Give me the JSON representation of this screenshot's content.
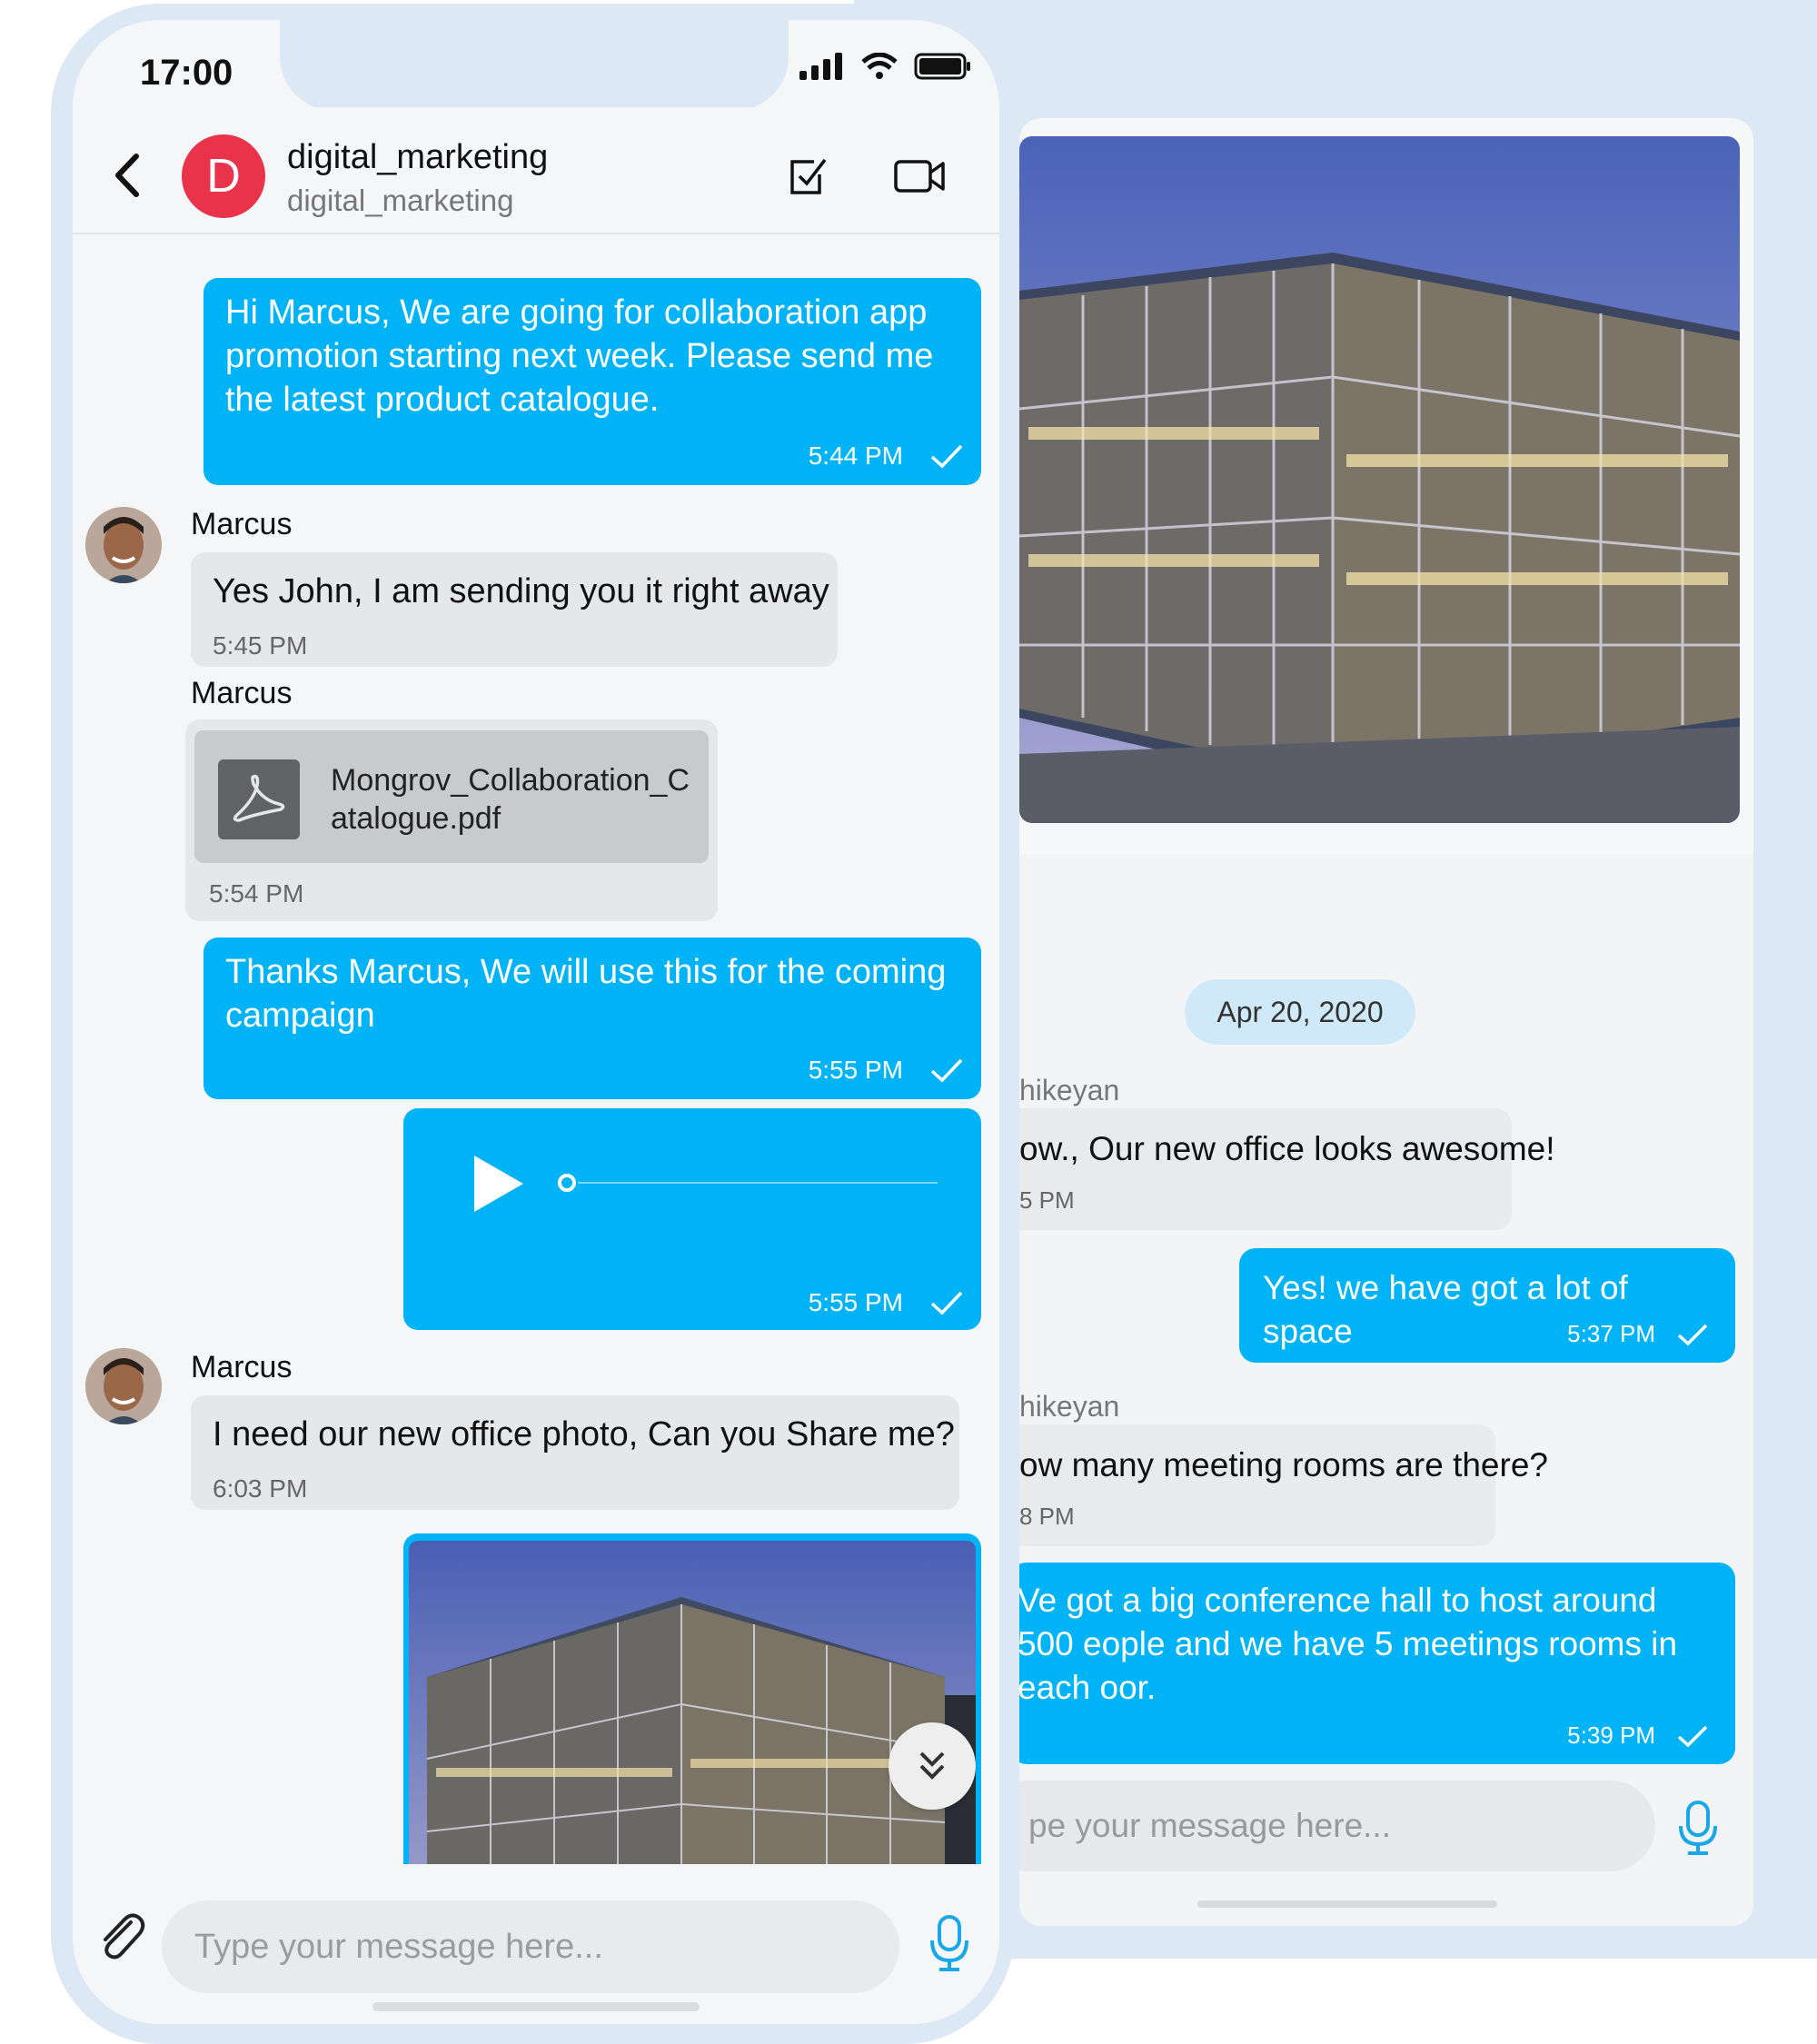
{
  "colors": {
    "accent": "#00b3f6",
    "avatar_red": "#e8334a",
    "incoming_bubble": "#e6e7e9",
    "date_pill": "#cfe9f8"
  },
  "left_phone": {
    "status": {
      "time": "17:00",
      "icons": [
        "signal-icon",
        "wifi-icon",
        "battery-icon"
      ]
    },
    "header": {
      "avatar_letter": "D",
      "title": "digital_marketing",
      "subtitle": "digital_marketing",
      "icons": [
        "back-arrow-icon",
        "task-check-icon",
        "video-camera-icon"
      ]
    },
    "messages": [
      {
        "type": "outgoing",
        "text": "Hi Marcus, We are going for collaboration app promotion starting next week. Please send me the latest product catalogue.",
        "time": "5:44 PM"
      },
      {
        "type": "incoming",
        "sender": "Marcus",
        "text": "Yes John, I am sending you it right away",
        "time": "5:45 PM"
      },
      {
        "type": "file",
        "sender": "Marcus",
        "file_name": "Mongrov_Collaboration_Catalogue.pdf",
        "time": "5:54 PM"
      },
      {
        "type": "outgoing",
        "text": "Thanks Marcus, We will use this for the coming campaign",
        "time": "5:55 PM"
      },
      {
        "type": "audio",
        "time": "5:55 PM",
        "progress": 0
      },
      {
        "type": "incoming",
        "sender": "Marcus",
        "text": "I need our new office photo, Can you Share me?",
        "time": "6:03 PM"
      },
      {
        "type": "image"
      }
    ],
    "composer": {
      "placeholder": "Type your message here..."
    }
  },
  "right_phone": {
    "date": "Apr 20, 2020",
    "messages": [
      {
        "type": "incoming",
        "sender": "hikeyan",
        "text": "ow., Our new office looks awesome!",
        "time": "5 PM"
      },
      {
        "type": "outgoing",
        "text": "Yes! we have got a lot of space",
        "time": "5:37 PM"
      },
      {
        "type": "incoming",
        "sender": "hikeyan",
        "text": "ow many meeting rooms are there?",
        "time": "8 PM"
      },
      {
        "type": "outgoing",
        "text": "Ve got a big conference hall to host around 500 eople and we have 5 meetings rooms in each oor.",
        "time": "5:39 PM"
      }
    ],
    "composer": {
      "placeholder": "pe your message here..."
    }
  }
}
